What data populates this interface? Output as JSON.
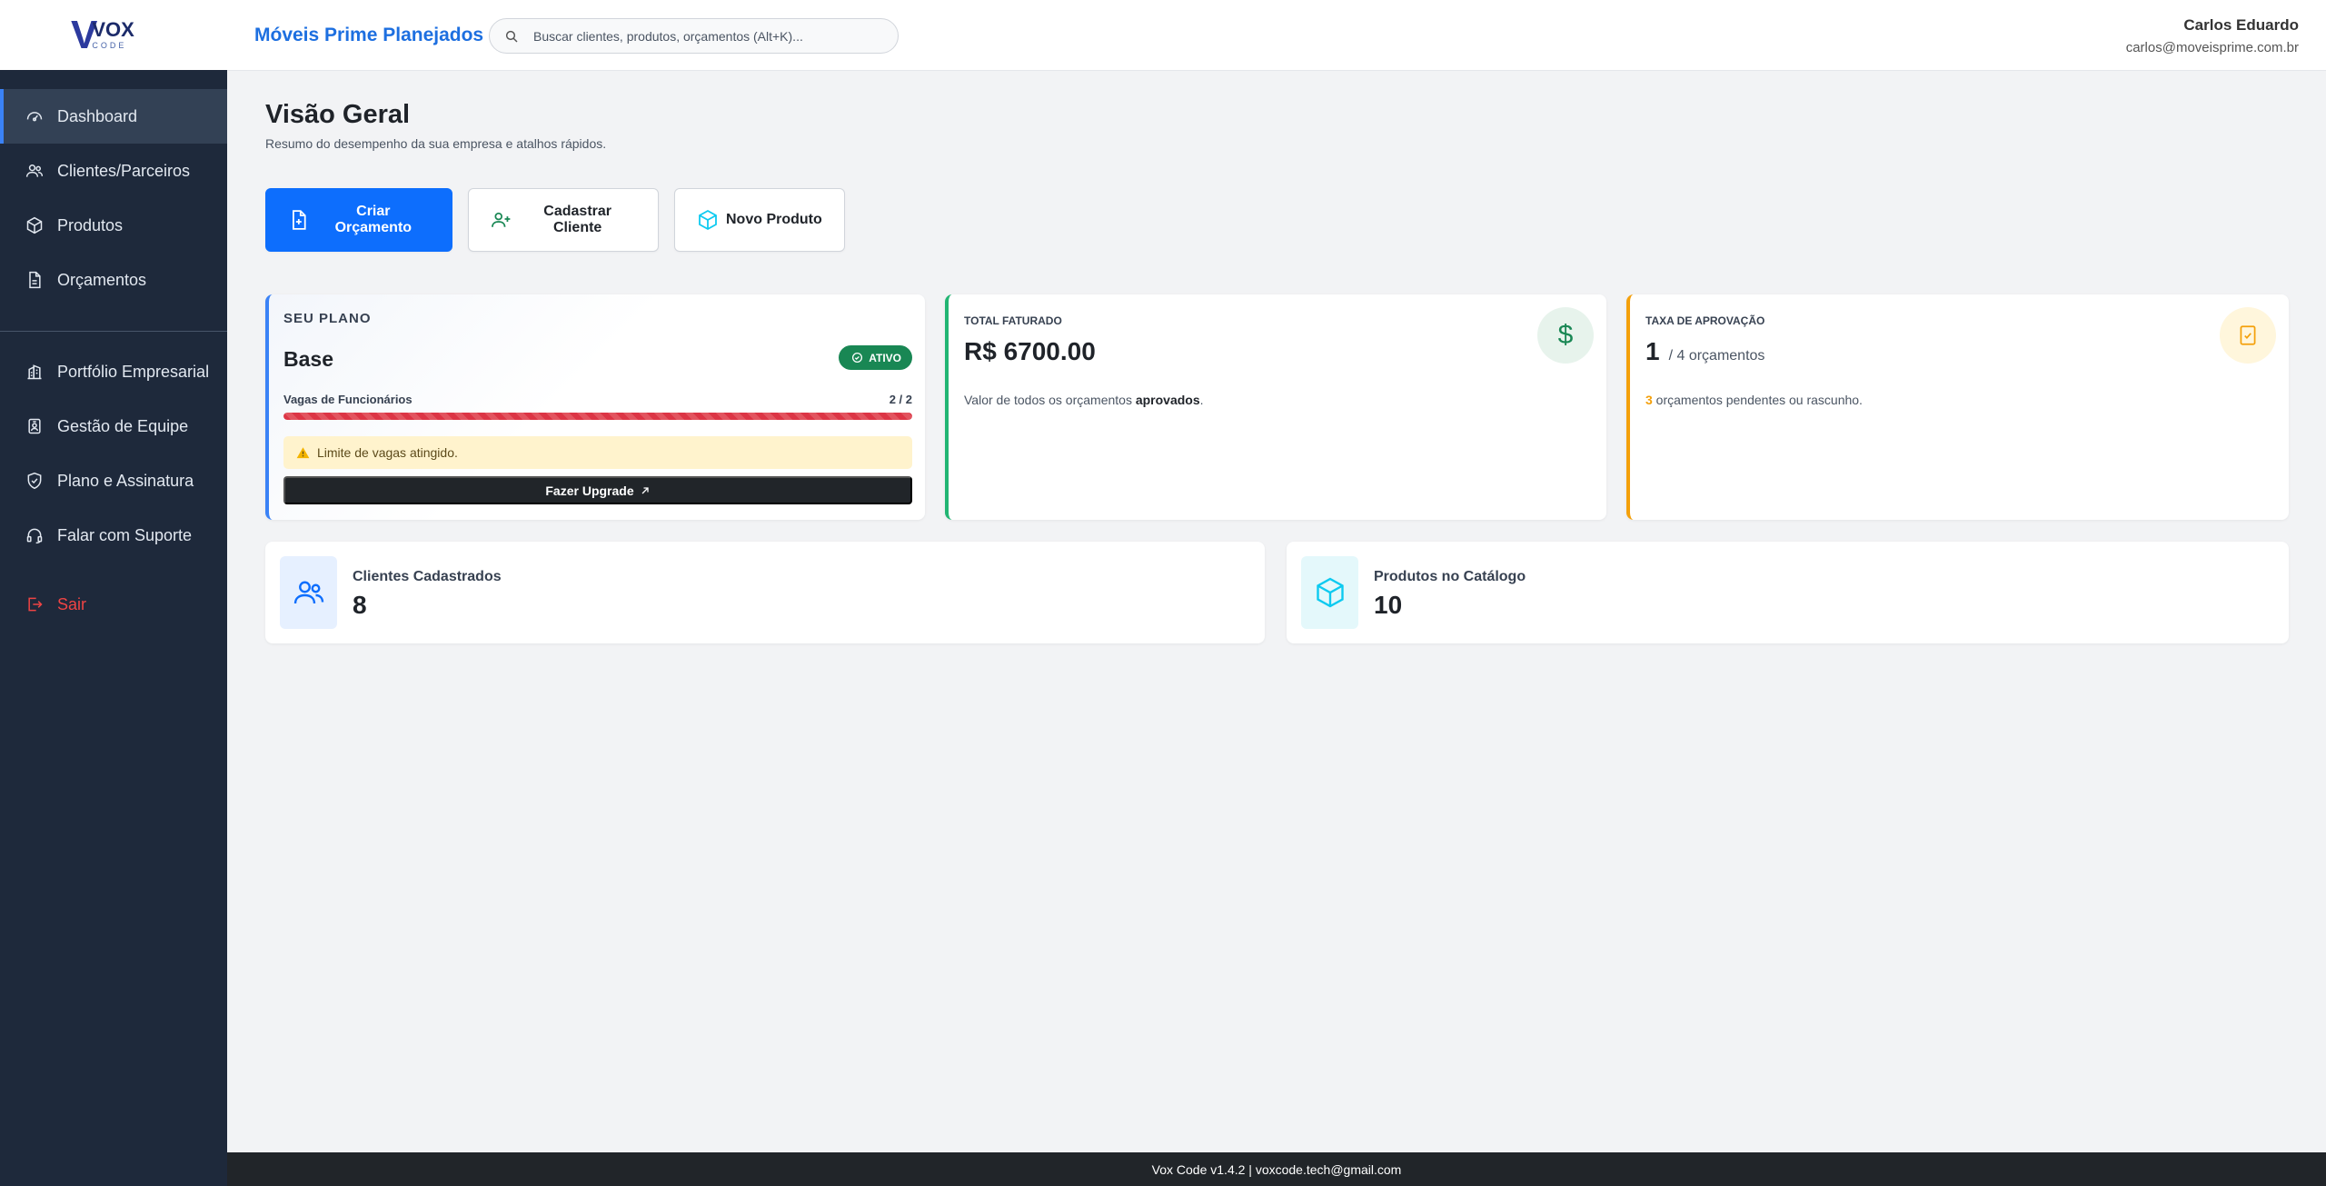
{
  "brand": {
    "logo_letter": "V",
    "logo_name": "VOX",
    "logo_sub": "CODE"
  },
  "sidebar": {
    "items": [
      {
        "label": "Dashboard",
        "icon": "gauge-icon",
        "active": true
      },
      {
        "label": "Clientes/Parceiros",
        "icon": "users-icon"
      },
      {
        "label": "Produtos",
        "icon": "box-icon"
      },
      {
        "label": "Orçamentos",
        "icon": "document-icon"
      },
      {
        "label": "Portfólio Empresarial",
        "icon": "building-icon"
      },
      {
        "label": "Gestão de Equipe",
        "icon": "id-badge-icon"
      },
      {
        "label": "Plano e Assinatura",
        "icon": "shield-icon"
      },
      {
        "label": "Falar com Suporte",
        "icon": "headset-icon"
      }
    ],
    "logout_label": "Sair"
  },
  "header": {
    "company": "Móveis Prime Planejados",
    "search_placeholder": "Buscar clientes, produtos, orçamentos (Alt+K)...",
    "user_name": "Carlos Eduardo",
    "user_email": "carlos@moveisprime.com.br"
  },
  "main": {
    "title": "Visão Geral",
    "subtitle": "Resumo do desempenho da sua empresa e atalhos rápidos.",
    "actions": {
      "create_quote": "Criar Orçamento",
      "register_client": "Cadastrar Cliente",
      "new_product": "Novo Produto"
    },
    "plan": {
      "label": "SEU PLANO",
      "name": "Base",
      "badge": "ATIVO",
      "seats_label": "Vagas de Funcionários",
      "seats_count": "2 / 2",
      "seats_used_fraction": 1.0,
      "alert": "Limite de vagas atingido.",
      "upgrade_label": "Fazer Upgrade"
    },
    "total": {
      "label": "TOTAL FATURADO",
      "value": "R$ 6700.00",
      "desc_prefix": "Valor de todos os orçamentos ",
      "desc_bold": "aprovados",
      "desc_suffix": ".",
      "icon": "$"
    },
    "approval": {
      "label": "TAXA DE APROVAÇÃO",
      "value": "1",
      "of_text": "/ 4 orçamentos",
      "pending_count": "3",
      "pending_text": " orçamentos pendentes ou rascunho."
    },
    "clients": {
      "label": "Clientes Cadastrados",
      "value": "8"
    },
    "products": {
      "label": "Produtos no Catálogo",
      "value": "10"
    }
  },
  "footer": {
    "text": "Vox Code v1.4.2 | voxcode.tech@gmail.com"
  },
  "colors": {
    "sidebar_bg": "#1e293b",
    "primary": "#0d6efd",
    "success": "#198754",
    "warning": "#f4a00b",
    "danger": "#dc3545"
  }
}
